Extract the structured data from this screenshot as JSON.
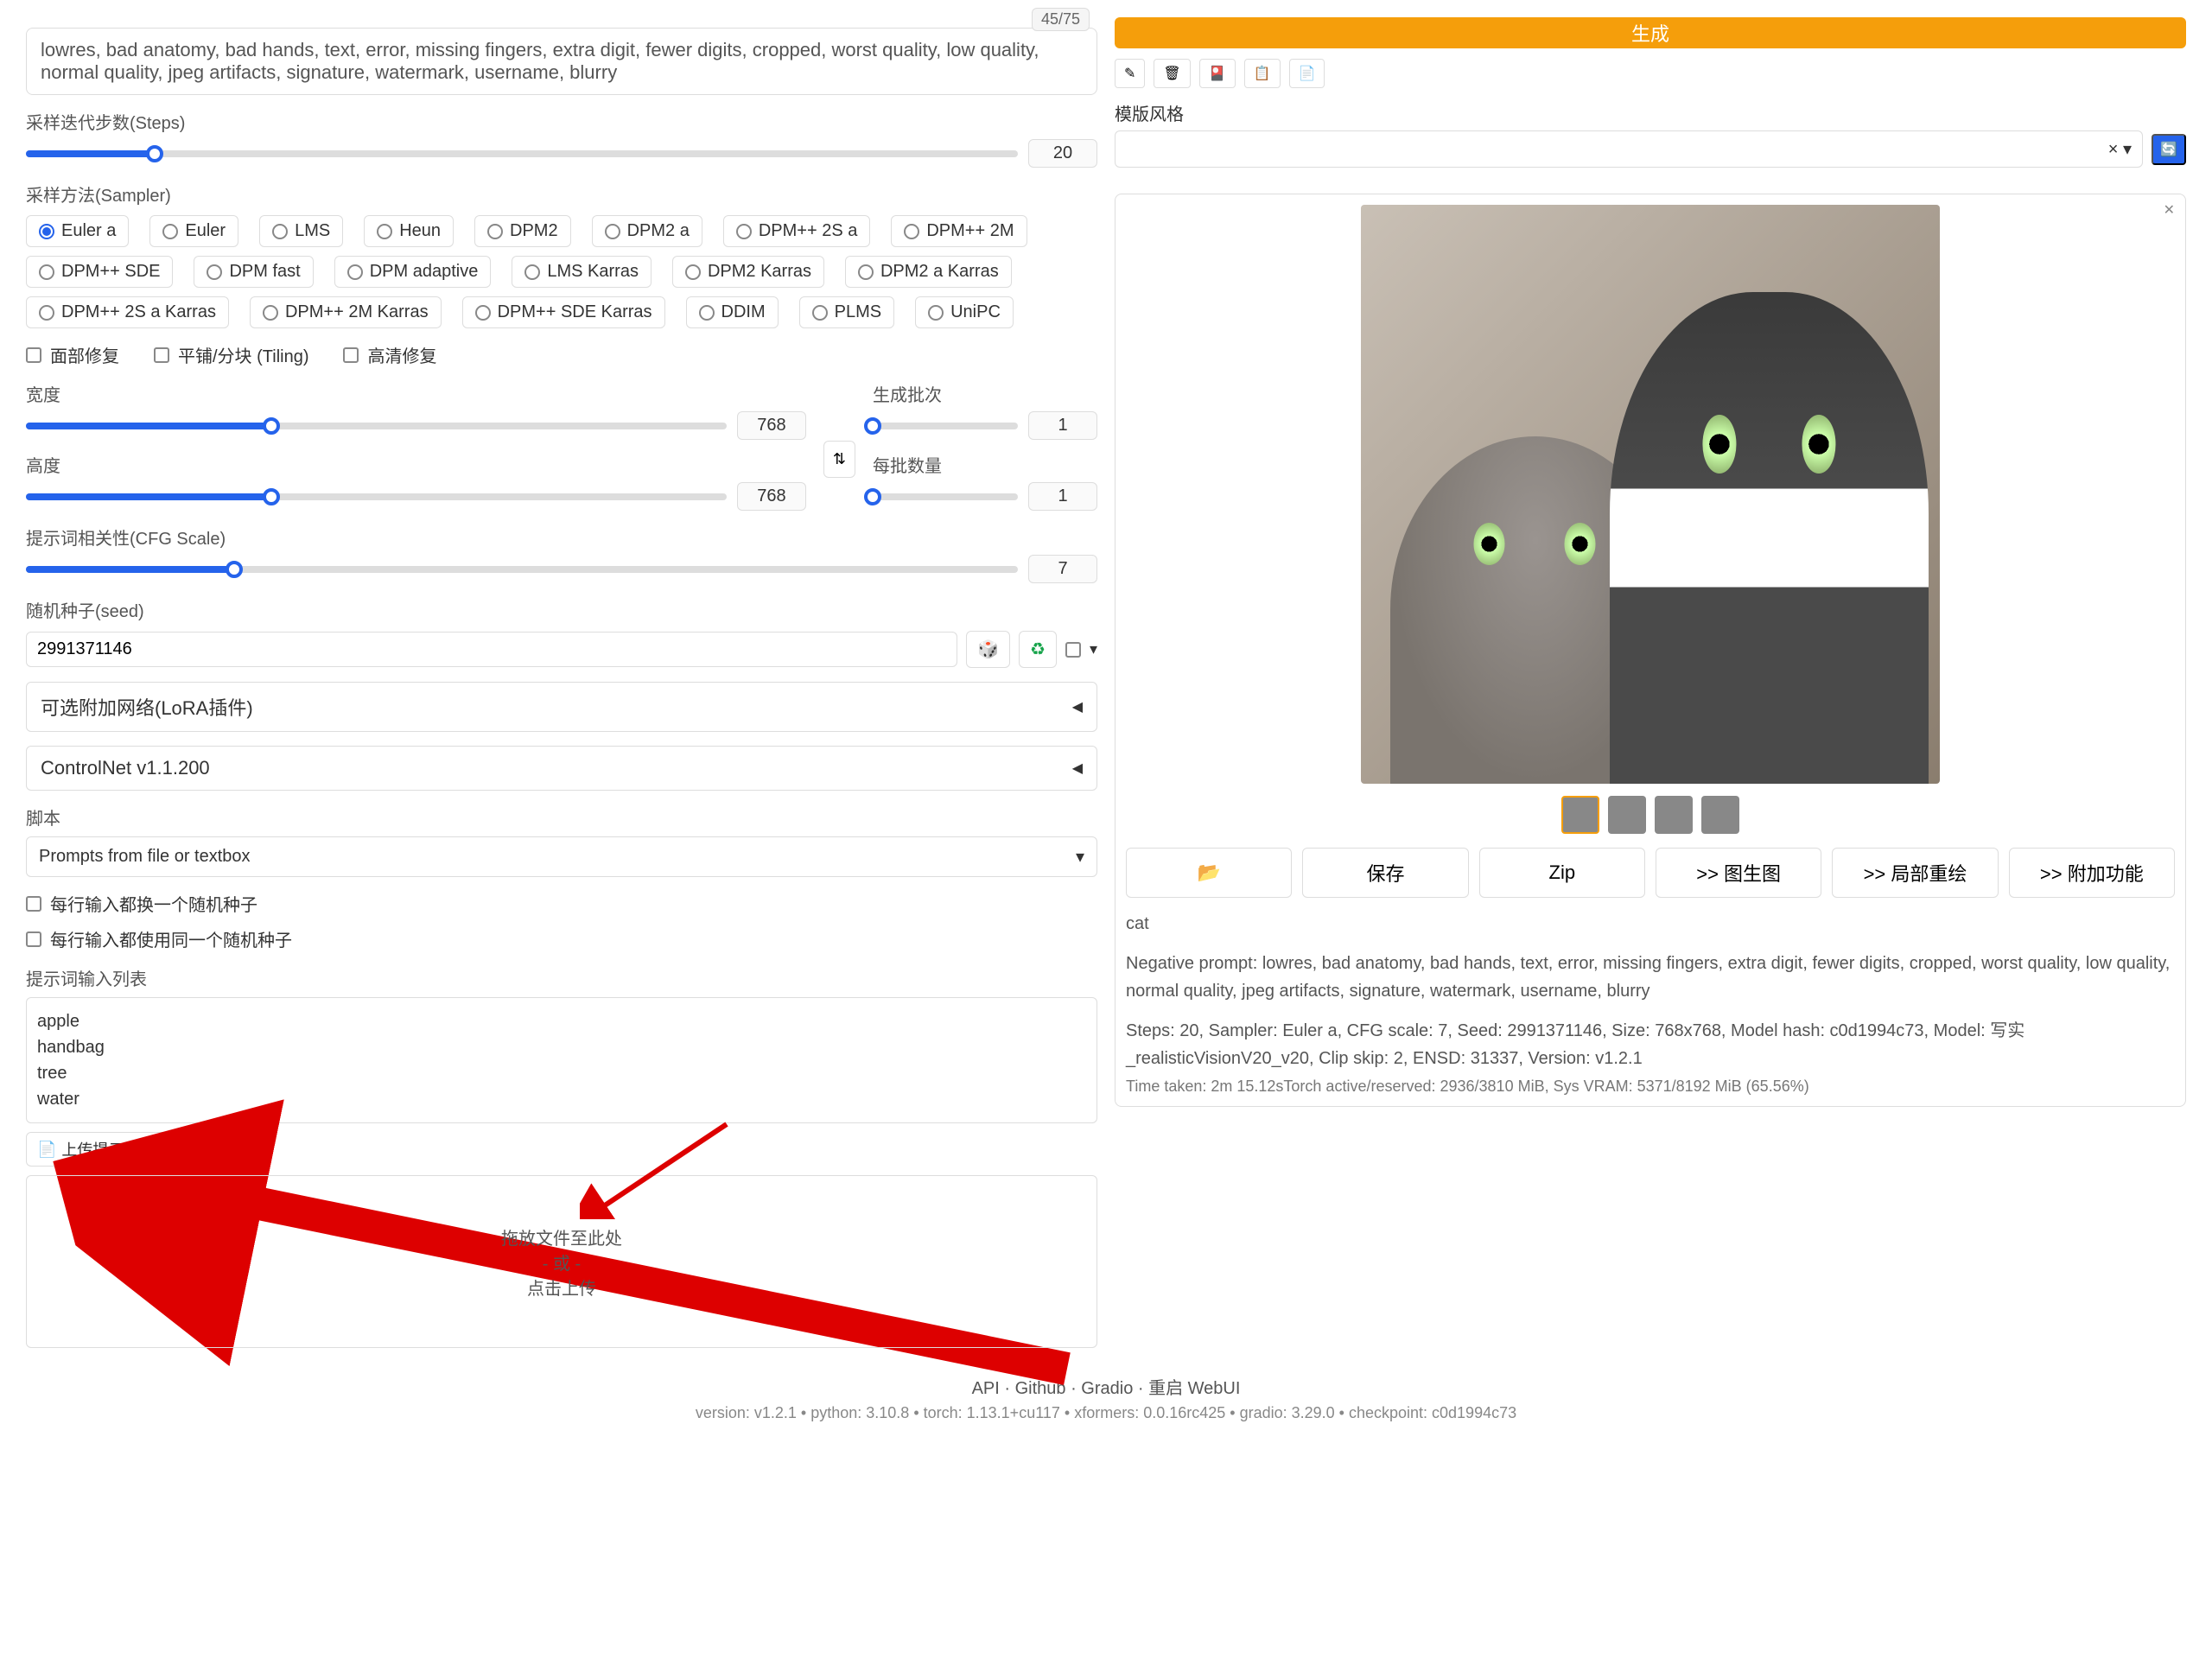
{
  "neg_prompt": "lowres, bad anatomy, bad hands, text, error, missing fingers, extra digit, fewer digits, cropped, worst quality, low quality, normal quality, jpeg artifacts, signature, watermark, username, blurry",
  "token_count": "45/75",
  "steps": {
    "label": "采样迭代步数(Steps)",
    "value": "20",
    "pct": 13
  },
  "sampler": {
    "label": "采样方法(Sampler)",
    "selected": "Euler a",
    "items": [
      "Euler a",
      "Euler",
      "LMS",
      "Heun",
      "DPM2",
      "DPM2 a",
      "DPM++ 2S a",
      "DPM++ 2M",
      "DPM++ SDE",
      "DPM fast",
      "DPM adaptive",
      "LMS Karras",
      "DPM2 Karras",
      "DPM2 a Karras",
      "DPM++ 2S a Karras",
      "DPM++ 2M Karras",
      "DPM++ SDE Karras",
      "DDIM",
      "PLMS",
      "UniPC"
    ]
  },
  "checks": {
    "face": "面部修复",
    "tiling": "平铺/分块 (Tiling)",
    "hires": "高清修复"
  },
  "width": {
    "label": "宽度",
    "value": "768",
    "pct": 35
  },
  "height": {
    "label": "高度",
    "value": "768",
    "pct": 35
  },
  "batch_count": {
    "label": "生成批次",
    "value": "1",
    "pct": 0
  },
  "batch_size": {
    "label": "每批数量",
    "value": "1",
    "pct": 0
  },
  "cfg": {
    "label": "提示词相关性(CFG Scale)",
    "value": "7",
    "pct": 21
  },
  "seed": {
    "label": "随机种子(seed)",
    "value": "2991371146"
  },
  "lora": "可选附加网络(LoRA插件)",
  "controlnet": "ControlNet v1.1.200",
  "script": {
    "label": "脚本",
    "value": "Prompts from file or textbox"
  },
  "iter_seed": "每行输入都换一个随机种子",
  "same_seed": "每行输入都使用同一个随机种子",
  "prompt_list_label": "提示词输入列表",
  "prompt_list": "apple\nhandbag\ntree\nwater",
  "upload_label": "上传提示词输入文件",
  "dropzone": {
    "l1": "拖放文件至此处",
    "l2": "- 或 -",
    "l3": "点击上传"
  },
  "gen_btn": "生成",
  "style_label": "模版风格",
  "out": {
    "prompt": "cat",
    "neg": "Negative prompt: lowres, bad anatomy, bad hands, text, error, missing fingers, extra digit, fewer digits, cropped, worst quality, low quality, normal quality, jpeg artifacts, signature, watermark, username, blurry",
    "params": "Steps: 20, Sampler: Euler a, CFG scale: 7, Seed: 2991371146, Size: 768x768, Model hash: c0d1994c73, Model: 写实_realisticVisionV20_v20, Clip skip: 2, ENSD: 31337, Version: v1.2.1",
    "time": "Time taken: 2m 15.12sTorch active/reserved: 2936/3810 MiB, Sys VRAM: 5371/8192 MiB (65.56%)"
  },
  "buttons": {
    "folder": "📂",
    "save": "保存",
    "zip": "Zip",
    "img2img": ">> 图生图",
    "inpaint": ">> 局部重绘",
    "extras": ">> 附加功能"
  },
  "footer": {
    "links": "API  ·  Github  ·  Gradio  ·  重启 WebUI",
    "ver": "version: v1.2.1  •  python: 3.10.8  •  torch: 1.13.1+cu117  •  xformers: 0.0.16rc425  •  gradio: 3.29.0  •  checkpoint: c0d1994c73"
  }
}
